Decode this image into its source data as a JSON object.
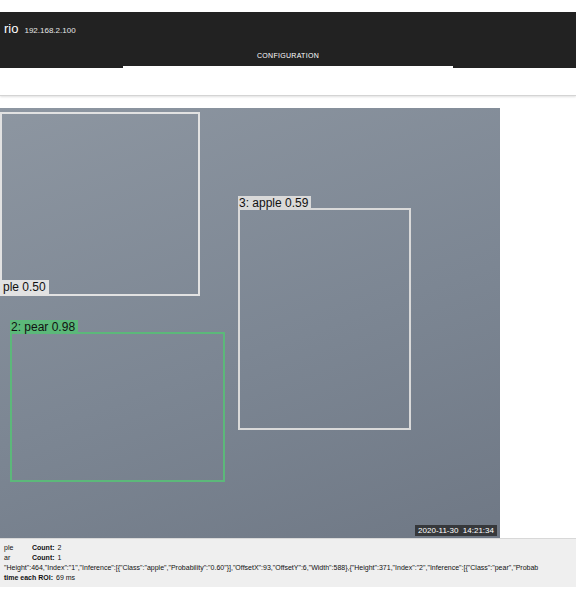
{
  "header": {
    "app_name": "rio",
    "address": "192.168.2.100"
  },
  "tabs": [
    {
      "label": "CONFIGURATION",
      "selected": true
    }
  ],
  "camera_view": {
    "timestamp": "2020-11-30  14:21:34",
    "detections": [
      {
        "label": "ple 0.50",
        "color": "#e2e2e2"
      },
      {
        "label": "3: apple 0.59",
        "color": "#d9d9d9"
      },
      {
        "label": "2: pear 0.98",
        "color": "#5cb87a"
      }
    ]
  },
  "results": {
    "counts": [
      {
        "class": "ple",
        "count_label": "Count:",
        "count": "2"
      },
      {
        "class": "ar",
        "count_label": "Count:",
        "count": "1"
      }
    ],
    "raw": "\"Height\":464,\"Index\":\"1\",\"Inference\":[{\"Class\":\"apple\",\"Probability\":\"0.60\"}],\"OffsetX\":93,\"OffsetY\":6,\"Width\":588},{\"Height\":371,\"Index\":\"2\",\"Inference\":[{\"Class\":\"pear\",\"Probab",
    "timing": {
      "label": "time each ROI:",
      "value": "69 ms"
    }
  }
}
